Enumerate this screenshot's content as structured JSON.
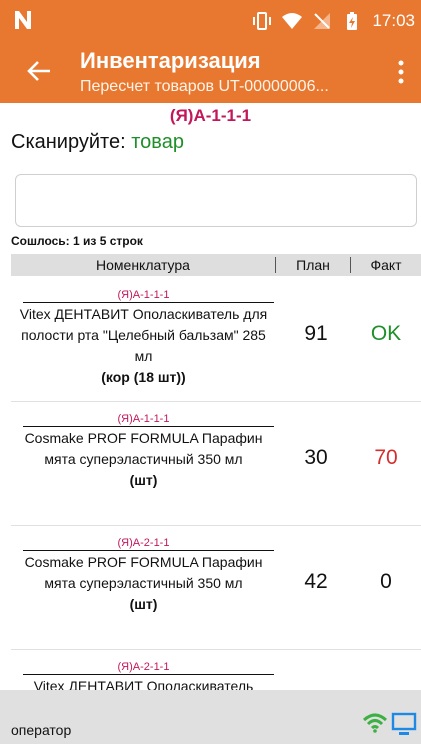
{
  "status_bar": {
    "time": "17:03",
    "icons": [
      "n-logo-icon",
      "vibrate-icon",
      "wifi-icon",
      "no-signal-icon",
      "battery-icon"
    ]
  },
  "appbar": {
    "title": "Инвентаризация",
    "subtitle": "Пересчет товаров UT-00000006..."
  },
  "cell_code": "(Я)А-1-1-1",
  "prompt": {
    "label": "Сканируйте:",
    "value": "товар"
  },
  "scan_input": {
    "value": "",
    "placeholder": ""
  },
  "matched_text": "Сошлось: 1 из 5 строк",
  "table": {
    "headers": [
      "Номенклатура",
      "План",
      "Факт"
    ],
    "rows": [
      {
        "location": "(Я)А-1-1-1",
        "name": "Vitex ДЕНТАВИТ Ополаскиватель для полости рта \"Целебный бальзам\" 285 мл",
        "unit": "(кор (18 шт))",
        "plan": "91",
        "fact": "OK",
        "fact_color": "#1f8f2a"
      },
      {
        "location": "(Я)А-1-1-1",
        "name": "Cosmake PROF FORMULA Парафин мята суперэластичный 350 мл",
        "unit": "(шт)",
        "plan": "30",
        "fact": "70",
        "fact_color": "#d32f2f"
      },
      {
        "location": "(Я)А-2-1-1",
        "name": "Cosmake PROF FORMULA Парафин мята суперэластичный 350 мл",
        "unit": "(шт)",
        "plan": "42",
        "fact": "0",
        "fact_color": "#111111"
      },
      {
        "location": "(Я)А-2-1-1",
        "name": "Vitex ДЕНТАВИТ Ополаскиватель",
        "unit": "",
        "plan": "",
        "fact": "",
        "fact_color": "#111111"
      }
    ]
  },
  "bottom_bar": {
    "operator": "оператор"
  },
  "colors": {
    "accent": "#e8782f",
    "location": "#c2185b",
    "ok": "#1f8f2a",
    "wifi": "#3cb043",
    "pc": "#1e88e5"
  }
}
